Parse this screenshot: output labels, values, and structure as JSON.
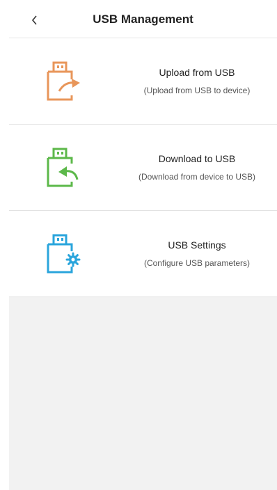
{
  "header": {
    "title": "USB Management",
    "back_icon": "chevron-left-icon"
  },
  "items": [
    {
      "label": "Upload from USB",
      "desc": "(Upload from USB to device)",
      "icon": "usb-upload-icon",
      "color": "#e8965a"
    },
    {
      "label": "Download to USB",
      "desc": "(Download from device to USB)",
      "icon": "usb-download-icon",
      "color": "#5cb84a"
    },
    {
      "label": "USB Settings",
      "desc": "(Configure USB parameters)",
      "icon": "usb-settings-icon",
      "color": "#2aa5dc"
    }
  ]
}
